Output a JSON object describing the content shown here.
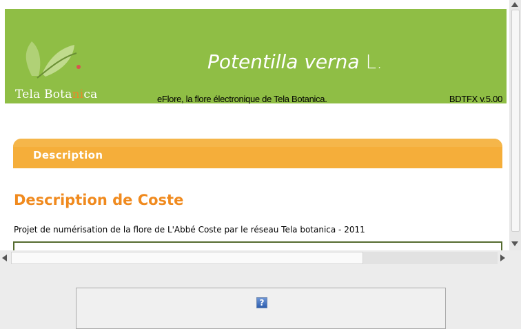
{
  "header": {
    "logo_text_part1": "Tela Bota",
    "logo_text_part2": "ni",
    "logo_text_part3": "ca",
    "species_name": "Potentilla verna",
    "author": "L.",
    "tagline": "eFlore, la flore électronique de Tela Botanica.",
    "version": "BDTFX v.5.00",
    "colors": {
      "background": "#8fbe45",
      "logo_accent": "#e88a2a"
    }
  },
  "section": {
    "label": "Description",
    "color": "#f5ae3a"
  },
  "description": {
    "title": "Description de Coste",
    "subtitle": "Projet de numérisation de la flore de L'Abbé Coste par le réseau Tela botanica - 2011",
    "title_color": "#f08a1e"
  },
  "placeholder": {
    "icon_glyph": "?",
    "icon_name": "missing-image-icon"
  },
  "scrollbars": {
    "vertical_scroll_fraction": 0.0,
    "horizontal_scroll_fraction": 0.0
  }
}
